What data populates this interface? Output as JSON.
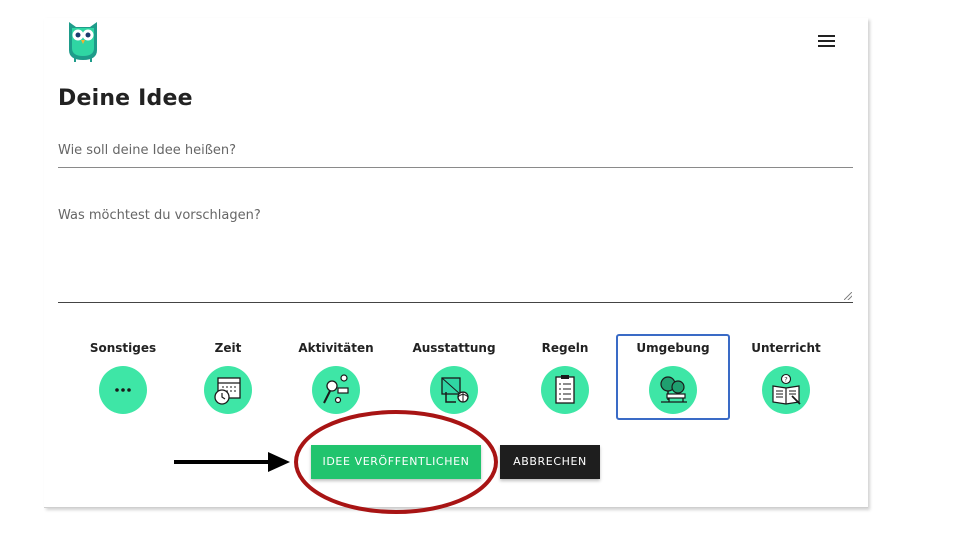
{
  "header": {
    "logo_icon": "owl-logo-icon",
    "menu_icon": "hamburger-menu-icon"
  },
  "form": {
    "title": "Deine Idee",
    "name_placeholder": "Wie soll deine Idee heißen?",
    "description_placeholder": "Was möchtest du vorschlagen?"
  },
  "categories": [
    {
      "label": "Sonstiges",
      "icon": "more-dots-icon",
      "selected": false
    },
    {
      "label": "Zeit",
      "icon": "calendar-clock-icon",
      "selected": false
    },
    {
      "label": "Aktivitäten",
      "icon": "activities-icon",
      "selected": false
    },
    {
      "label": "Ausstattung",
      "icon": "equipment-icon",
      "selected": false
    },
    {
      "label": "Regeln",
      "icon": "clipboard-rules-icon",
      "selected": false
    },
    {
      "label": "Umgebung",
      "icon": "environment-trees-bench-icon",
      "selected": true
    },
    {
      "label": "Unterricht",
      "icon": "book-lesson-icon",
      "selected": false
    }
  ],
  "actions": {
    "publish_label": "IDEE VERÖFFENTLICHEN",
    "cancel_label": "ABBRECHEN"
  },
  "annotations": {
    "arrow": "pointer-arrow",
    "highlight": "red-ellipse-highlight"
  },
  "colors": {
    "accent_green": "#21c46e",
    "icon_circle": "#3ee6a6",
    "selected_border": "#3a6bc6",
    "cancel_bg": "#1e1e1e",
    "highlight_red": "#a81414"
  }
}
